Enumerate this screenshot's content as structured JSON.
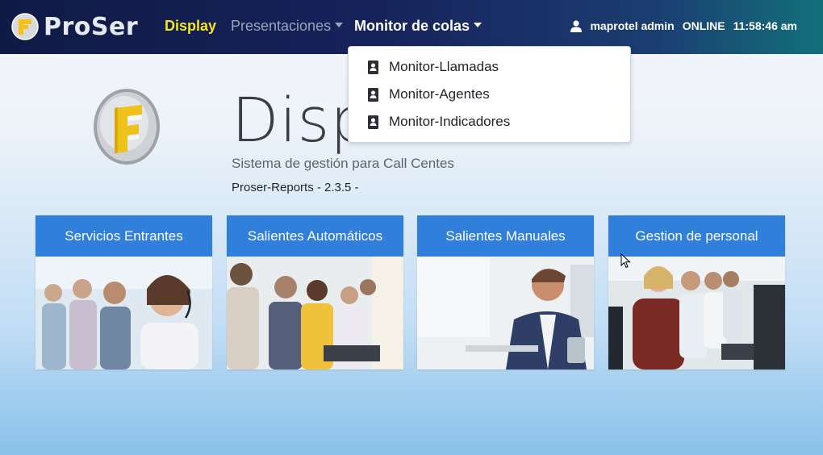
{
  "brand": {
    "name": "ProSer"
  },
  "nav": {
    "display": "Display",
    "presentaciones": "Presentaciones",
    "monitor": "Monitor de colas"
  },
  "user": {
    "name": "maprotel admin",
    "status": "ONLINE",
    "time": "11:58:46 am"
  },
  "dropdown": {
    "items": [
      {
        "label": "Monitor-Llamadas",
        "icon": "contact-card-icon"
      },
      {
        "label": "Monitor-Agentes",
        "icon": "contact-card-icon"
      },
      {
        "label": "Monitor-Indicadores",
        "icon": "contact-card-icon"
      }
    ]
  },
  "hero": {
    "title": "Disp",
    "subtitle": "Sistema de gestión para Call Centes",
    "version": "Proser-Reports - 2.3.5 -"
  },
  "cards": [
    {
      "title": "Servicios Entrantes"
    },
    {
      "title": "Salientes Automáticos"
    },
    {
      "title": "Salientes Manuales"
    },
    {
      "title": "Gestion de personal"
    }
  ],
  "colors": {
    "nav_active": "#f5e326",
    "card_header": "#2f7fdb",
    "nav_bg_start": "#0f1a45",
    "nav_bg_end": "#12707a"
  }
}
